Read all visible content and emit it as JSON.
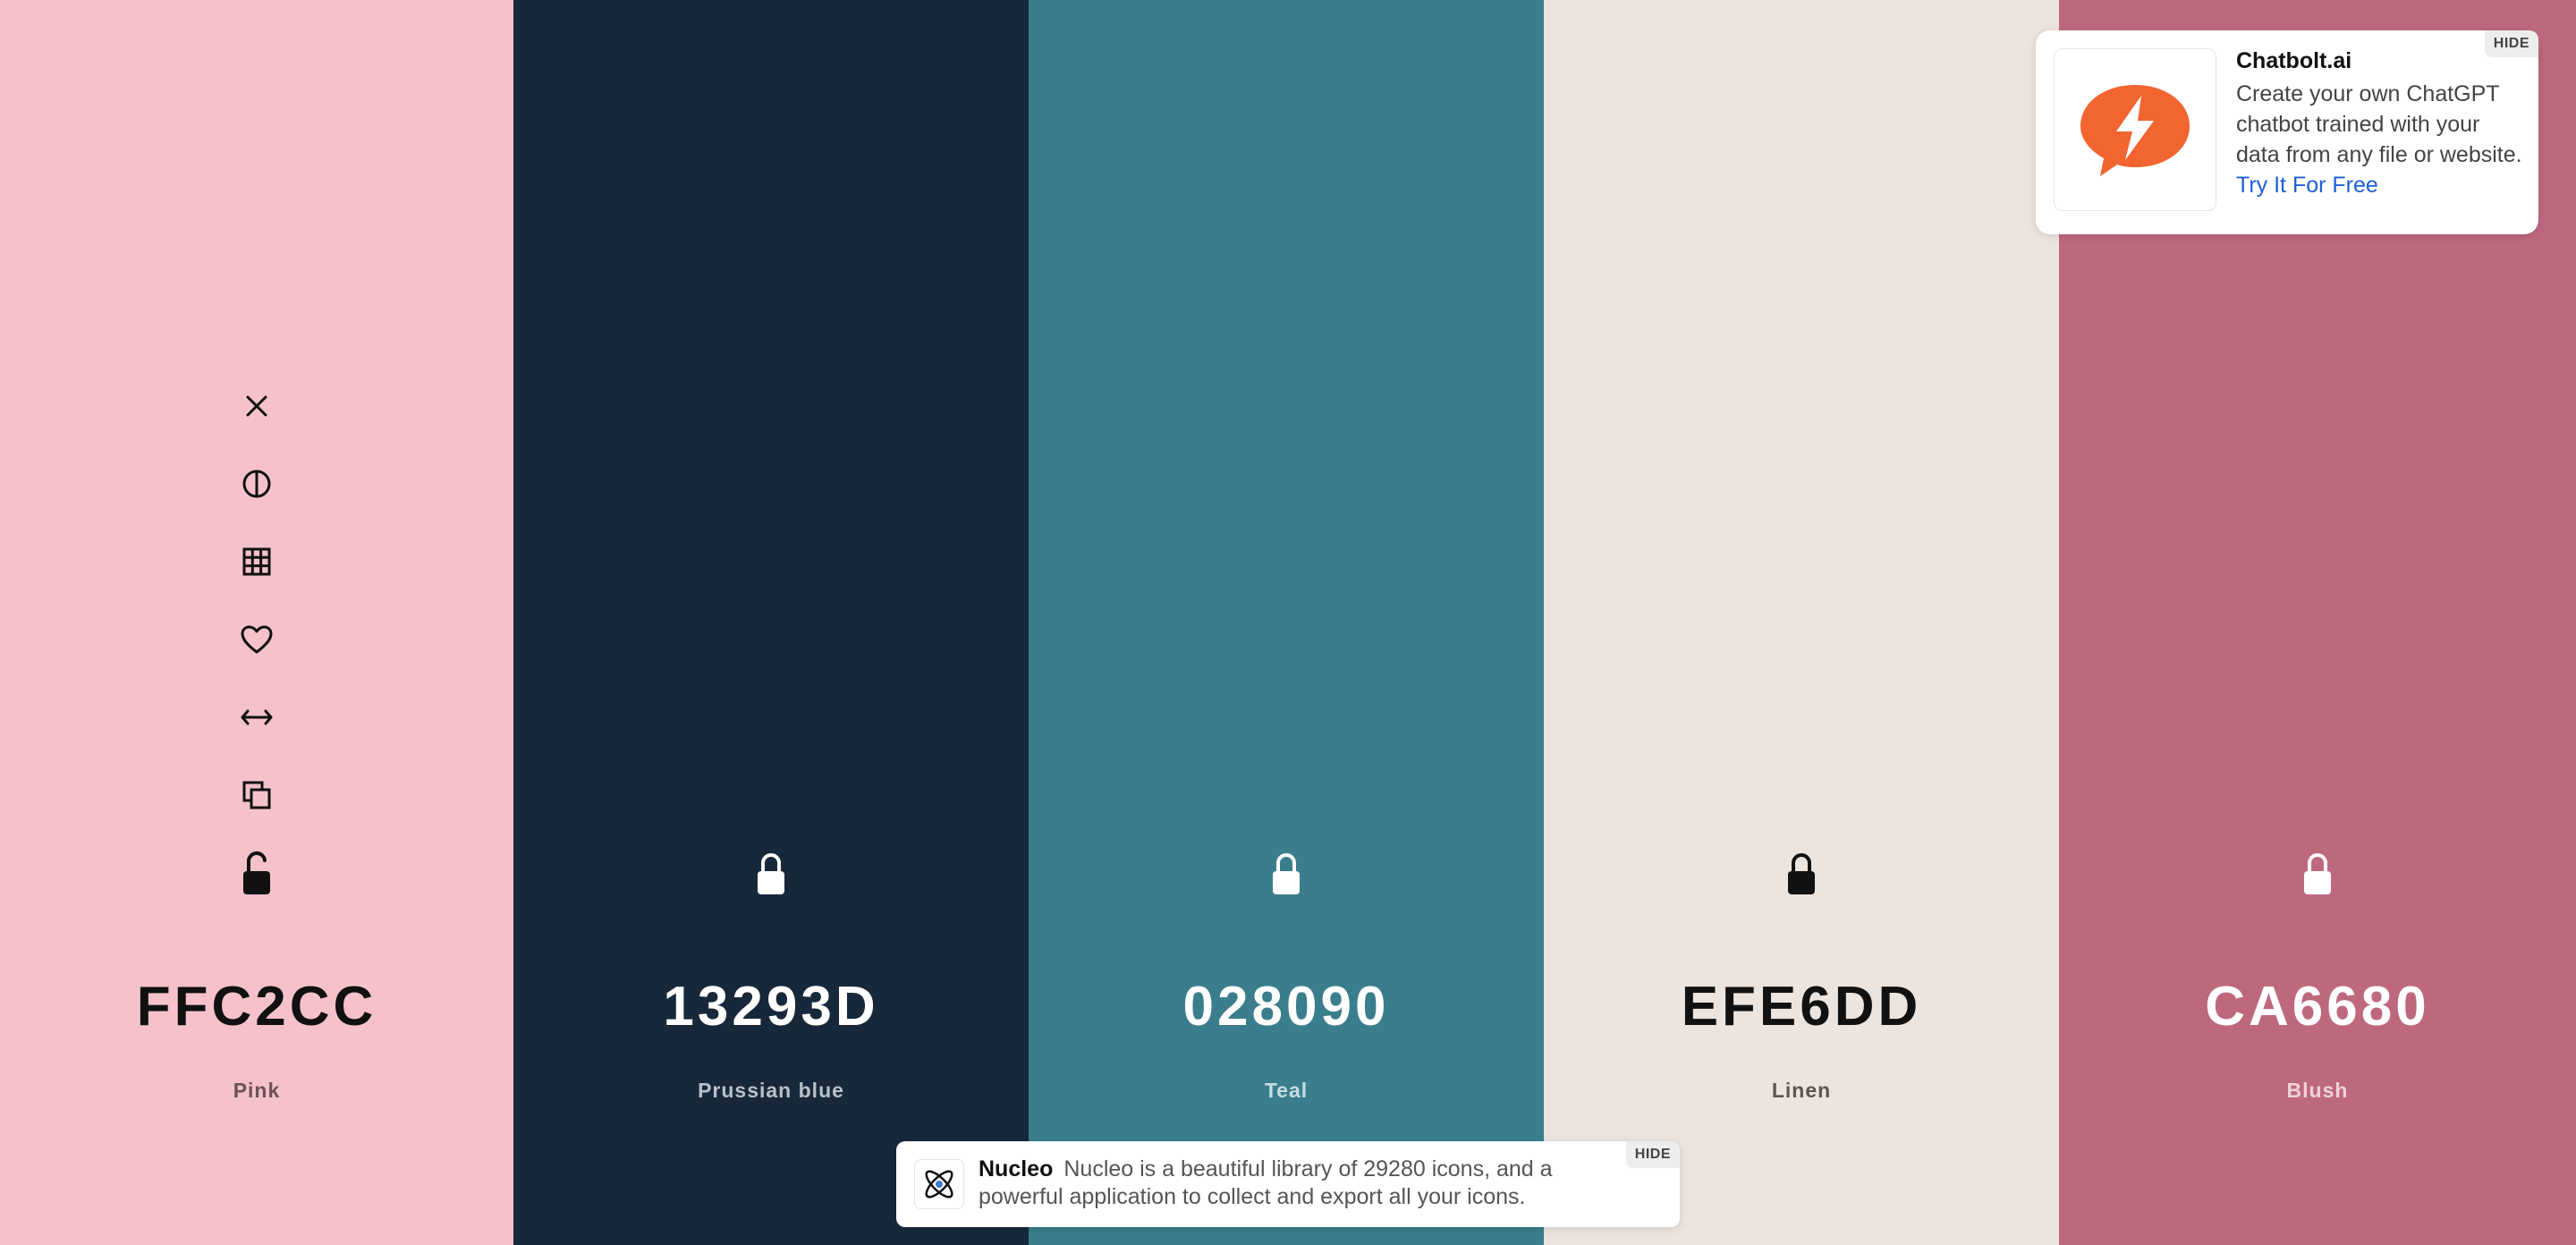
{
  "swatches": [
    {
      "hex": "FFC2CC",
      "name": "Pink",
      "bg": "#F5C2CB",
      "text_color": "#111111",
      "name_color": "#6b5257",
      "lock_color": "#111111",
      "locked": false
    },
    {
      "hex": "13293D",
      "name": "Prussian blue",
      "bg": "#18283B",
      "text_color": "#FFFFFF",
      "name_color": "#b9c0c8",
      "lock_color": "#FFFFFF",
      "locked": true
    },
    {
      "hex": "028090",
      "name": "Teal",
      "bg": "#3A7E8D",
      "text_color": "#FFFFFF",
      "name_color": "#c7dde1",
      "lock_color": "#FFFFFF",
      "locked": true
    },
    {
      "hex": "EFE6DD",
      "name": "Linen",
      "bg": "#ECE4DE",
      "text_color": "#111111",
      "name_color": "#5a5652",
      "lock_color": "#111111",
      "locked": true
    },
    {
      "hex": "CA6680",
      "name": "Blush",
      "bg": "#BE687E",
      "text_color": "#FFFFFF",
      "name_color": "#f0d3da",
      "lock_color": "#FFFFFF",
      "locked": true
    }
  ],
  "tools": [
    "close-icon",
    "contrast-icon",
    "grid-icon",
    "heart-icon",
    "arrows-horizontal-icon",
    "copy-icon"
  ],
  "ad": {
    "title": "Chatbolt.ai",
    "body": "Create your own ChatGPT chatbot trained with your data from any file or website.",
    "link": "Try It For Free",
    "hide": "HIDE",
    "logo_color": "#F26430"
  },
  "banner": {
    "title": "Nucleo",
    "body": "Nucleo is a beautiful library of 29280 icons, and a powerful application to collect and export all your icons.",
    "hide": "HIDE"
  }
}
